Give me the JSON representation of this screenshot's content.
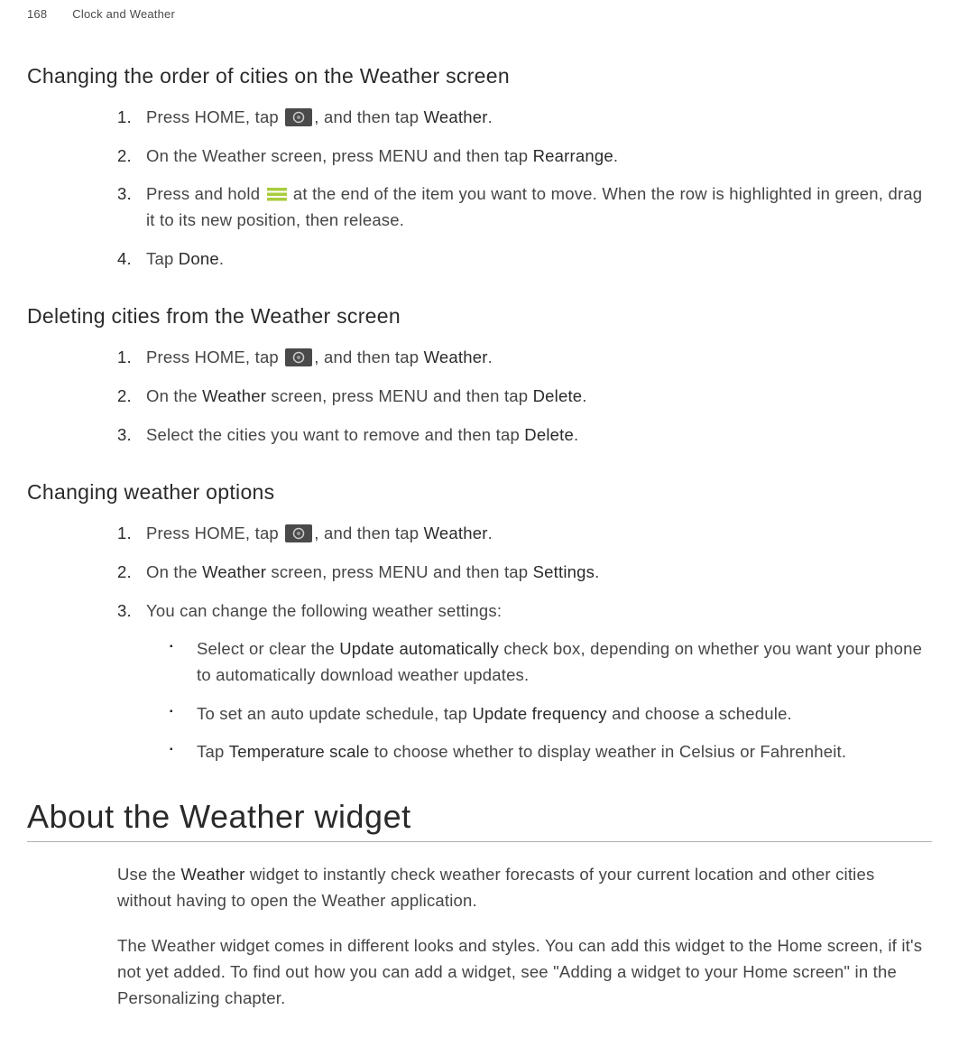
{
  "header": {
    "page_number": "168",
    "chapter": "Clock and Weather"
  },
  "sections": {
    "changing_order": {
      "title": "Changing the order of cities on the Weather screen",
      "step1_a": "Press HOME, tap ",
      "step1_b": ", and then tap ",
      "step1_bold": "Weather",
      "step1_c": ".",
      "step2_a": "On the Weather screen, press MENU and then tap ",
      "step2_bold": "Rearrange",
      "step2_b": ".",
      "step3_a": "Press and hold ",
      "step3_b": " at the end of the item you want to move. When the row is highlighted in green, drag it to its new position, then release.",
      "step4_a": "Tap ",
      "step4_bold": "Done",
      "step4_b": "."
    },
    "deleting": {
      "title": "Deleting cities from the Weather screen",
      "step1_a": "Press HOME, tap ",
      "step1_b": ", and then tap ",
      "step1_bold": "Weather",
      "step1_c": ".",
      "step2_a": "On the ",
      "step2_bold1": "Weather",
      "step2_b": " screen, press MENU and then tap ",
      "step2_bold2": "Delete",
      "step2_c": ".",
      "step3_a": "Select the cities you want to remove and then tap ",
      "step3_bold": "Delete",
      "step3_b": "."
    },
    "options": {
      "title": "Changing weather options",
      "step1_a": "Press HOME, tap ",
      "step1_b": ", and then tap ",
      "step1_bold": "Weather",
      "step1_c": ".",
      "step2_a": "On the ",
      "step2_bold1": "Weather",
      "step2_b": " screen, press MENU and then tap ",
      "step2_bold2": "Settings",
      "step2_c": ".",
      "step3": "You can change the following weather settings:",
      "b1_a": "Select or clear the ",
      "b1_bold": "Update automatically",
      "b1_b": " check box, depending on whether you want your phone to automatically download weather updates.",
      "b2_a": "To set an auto update schedule, tap ",
      "b2_bold": "Update frequency",
      "b2_b": " and choose a schedule.",
      "b3_a": "Tap ",
      "b3_bold": "Temperature scale",
      "b3_b": " to choose whether to display weather in Celsius or Fahrenheit."
    }
  },
  "widget": {
    "title": "About the Weather widget",
    "p1_a": "Use the ",
    "p1_bold": "Weather",
    "p1_b": " widget to instantly check weather forecasts of your current location and other cities without having to open the Weather application.",
    "p2": "The Weather widget comes in different looks and styles. You can add this widget to the Home screen, if it's not yet added. To find out how you can add a widget, see \"Adding a widget to your Home screen\" in the Personalizing chapter."
  }
}
